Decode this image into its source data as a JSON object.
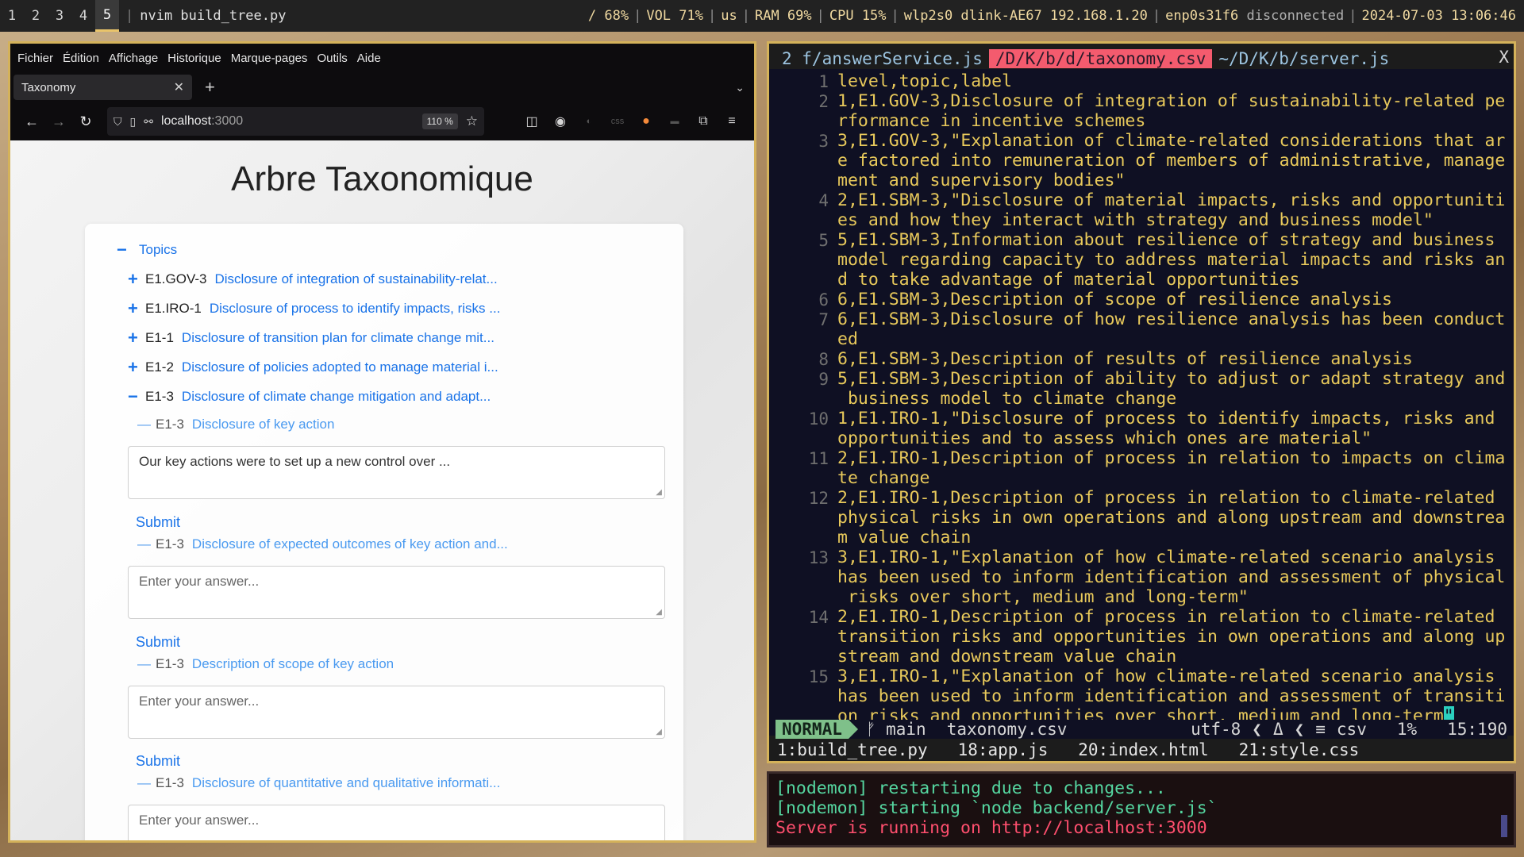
{
  "topbar": {
    "workspaces": [
      "1",
      "2",
      "3",
      "4",
      "5"
    ],
    "active_workspace": "5",
    "window_title": "nvim build_tree.py",
    "status": {
      "disk": "/ 68%",
      "volume": "VOL 71%",
      "layout": "us",
      "ram": "RAM 69%",
      "cpu": "CPU 15%",
      "wifi": "wlp2s0 dlink-AE67 192.168.1.20",
      "eth_iface": "enp0s31f6",
      "eth_state": "disconnected",
      "datetime": "2024-07-03 13:06:46"
    }
  },
  "browser": {
    "menu": [
      "Fichier",
      "Édition",
      "Affichage",
      "Historique",
      "Marque-pages",
      "Outils",
      "Aide"
    ],
    "tab_title": "Taxonomy",
    "url_host": "localhost",
    "url_port": ":3000",
    "zoom": "110 %",
    "page": {
      "title": "Arbre Taxonomique",
      "root": {
        "toggle": "−",
        "label": "Topics"
      },
      "topics": [
        {
          "toggle": "+",
          "code": "E1.GOV-3",
          "label": "Disclosure of integration of sustainability-relat..."
        },
        {
          "toggle": "+",
          "code": "E1.IRO-1",
          "label": "Disclosure of process to identify impacts, risks ..."
        },
        {
          "toggle": "+",
          "code": "E1-1",
          "label": "Disclosure of transition plan for climate change mit..."
        },
        {
          "toggle": "+",
          "code": "E1-2",
          "label": "Disclosure of policies adopted to manage material i..."
        },
        {
          "toggle": "−",
          "code": "E1-3",
          "label": "Disclosure of climate change mitigation and adapt..."
        }
      ],
      "subitems": [
        {
          "dash": "—",
          "code": "E1-3",
          "label": "Disclosure of key action",
          "answer": "Our key actions were to set up a new control over ...",
          "submit": "Submit"
        },
        {
          "dash": "—",
          "code": "E1-3",
          "label": "Disclosure of expected outcomes of key action and...",
          "placeholder": "Enter your answer...",
          "submit": "Submit"
        },
        {
          "dash": "—",
          "code": "E1-3",
          "label": "Description of scope of key action",
          "placeholder": "Enter your answer...",
          "submit": "Submit"
        },
        {
          "dash": "—",
          "code": "E1-3",
          "label": "Disclosure of quantitative and qualitative informati...",
          "placeholder": "Enter your answer..."
        }
      ]
    }
  },
  "editor": {
    "tabs": [
      {
        "label": "2 f/answerService.js"
      },
      {
        "label": "/D/K/b/d/taxonomy.csv"
      },
      {
        "label": "~/D/K/b/server.js"
      }
    ],
    "close": "X",
    "lines": [
      {
        "n": "1",
        "rows": [
          "level,topic,label"
        ]
      },
      {
        "n": "2",
        "rows": [
          "1,E1.GOV-3,Disclosure of integration of sustainability-related pe",
          "rformance in incentive schemes"
        ]
      },
      {
        "n": "3",
        "rows": [
          "3,E1.GOV-3,\"Explanation of climate-related considerations that ar",
          "e factored into remuneration of members of administrative, manage",
          "ment and supervisory bodies\""
        ]
      },
      {
        "n": "4",
        "rows": [
          "2,E1.SBM-3,\"Disclosure of material impacts, risks and opportuniti",
          "es and how they interact with strategy and business model\""
        ]
      },
      {
        "n": "5",
        "rows": [
          "5,E1.SBM-3,Information about resilience of strategy and business",
          "model regarding capacity to address material impacts and risks an",
          "d to take advantage of material opportunities"
        ]
      },
      {
        "n": "6",
        "rows": [
          "6,E1.SBM-3,Description of scope of resilience analysis"
        ]
      },
      {
        "n": "7",
        "rows": [
          "6,E1.SBM-3,Disclosure of how resilience analysis has been conduct",
          "ed"
        ]
      },
      {
        "n": "8",
        "rows": [
          "6,E1.SBM-3,Description of results of resilience analysis"
        ]
      },
      {
        "n": "9",
        "rows": [
          "5,E1.SBM-3,Description of ability to adjust or adapt strategy and",
          " business model to climate change"
        ]
      },
      {
        "n": "10",
        "rows": [
          "1,E1.IRO-1,\"Disclosure of process to identify impacts, risks and",
          "opportunities and to assess which ones are material\""
        ]
      },
      {
        "n": "11",
        "rows": [
          "2,E1.IRO-1,Description of process in relation to impacts on clima",
          "te change"
        ]
      },
      {
        "n": "12",
        "rows": [
          "2,E1.IRO-1,Description of process in relation to climate-related",
          "physical risks in own operations and along upstream and downstrea",
          "m value chain"
        ]
      },
      {
        "n": "13",
        "rows": [
          "3,E1.IRO-1,\"Explanation of how climate-related scenario analysis",
          "has been used to inform identification and assessment of physical",
          " risks over short, medium and long-term\""
        ]
      },
      {
        "n": "14",
        "rows": [
          "2,E1.IRO-1,Description of process in relation to climate-related",
          "transition risks and opportunities in own operations and along up",
          "stream and downstream value chain"
        ]
      },
      {
        "n": "15",
        "rows": [
          "3,E1.IRO-1,\"Explanation of how climate-related scenario analysis",
          "has been used to inform identification and assessment of transiti",
          "on risks and opportunities over short, medium and long-term"
        ]
      }
    ],
    "cursor_char": "\"",
    "statusline": {
      "mode": "NORMAL",
      "branch": "ᚠ main",
      "file": "taxonomy.csv",
      "encoding": "utf-8",
      "sep1": "❮",
      "os_icon": "Δ",
      "sep2": "❮",
      "ft_icon": "≡",
      "filetype": "csv",
      "percent": "1%",
      "position": "15:190"
    },
    "buffers": "1:build_tree.py   18:app.js   20:index.html   21:style.css"
  },
  "terminal": {
    "lines": [
      {
        "text": "[nodemon] restarting due to changes...",
        "color": "g"
      },
      {
        "text": "[nodemon] starting `node backend/server.js`",
        "color": "g"
      },
      {
        "text": "Server is running on http://localhost:3000",
        "color": "r"
      }
    ]
  }
}
